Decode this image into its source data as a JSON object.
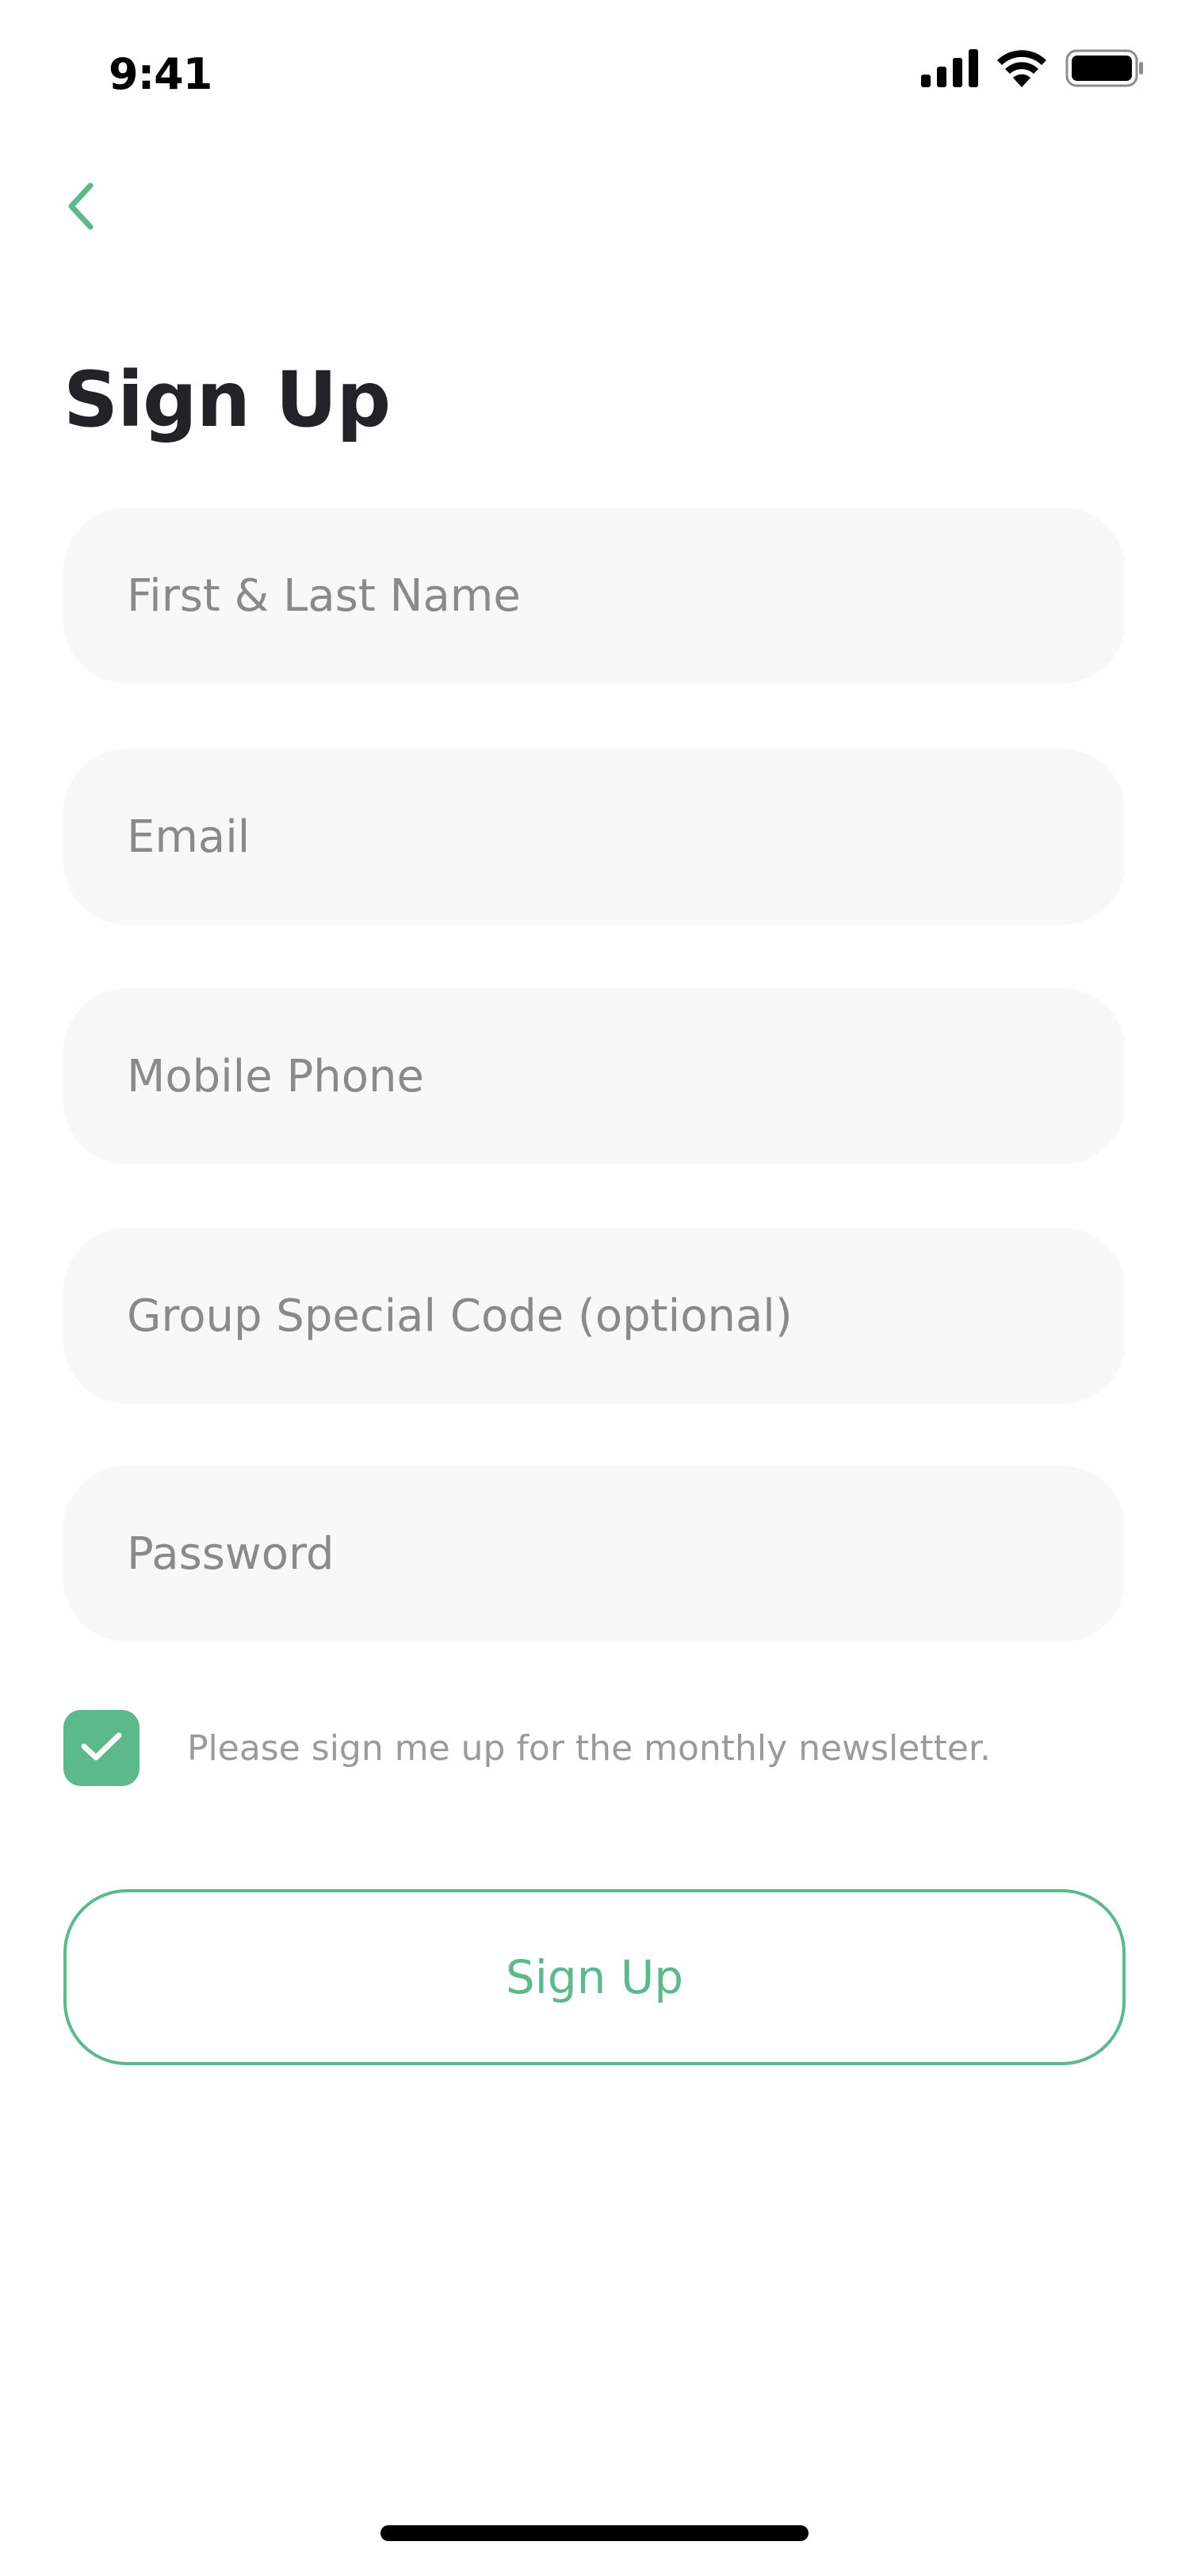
{
  "status_bar": {
    "time": "9:41",
    "icons": [
      "cellular-signal-icon",
      "wifi-icon",
      "battery-icon"
    ]
  },
  "nav": {
    "back_icon": "chevron-left-icon"
  },
  "page": {
    "title": "Sign Up"
  },
  "form": {
    "fields": [
      {
        "name": "full-name-input",
        "placeholder": "First & Last Name",
        "value": ""
      },
      {
        "name": "email-input",
        "placeholder": "Email",
        "value": ""
      },
      {
        "name": "mobile-phone-input",
        "placeholder": "Mobile Phone",
        "value": ""
      },
      {
        "name": "group-code-input",
        "placeholder": "Group Special Code (optional)",
        "value": ""
      },
      {
        "name": "password-input",
        "placeholder": "Password",
        "value": ""
      }
    ],
    "newsletter": {
      "checked": true,
      "label": "Please sign me up for the monthly newsletter."
    },
    "submit_label": "Sign Up"
  },
  "colors": {
    "accent": "#5bb98b",
    "field_bg": "#f8f8f8",
    "placeholder": "#8a8a8a",
    "title": "#232327"
  }
}
